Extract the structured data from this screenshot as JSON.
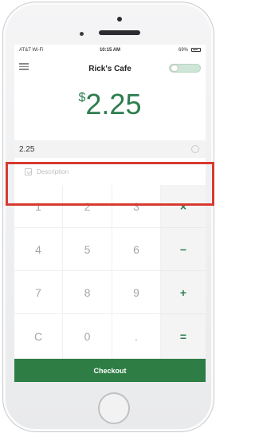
{
  "status_bar": {
    "carrier": "AT&T Wi-Fi",
    "time": "10:15 AM",
    "battery": "69%"
  },
  "header": {
    "title": "Rick's Cafe"
  },
  "amount": {
    "currency": "$",
    "value": "2.25"
  },
  "entry": {
    "value": "2.25"
  },
  "description": {
    "placeholder": "Description"
  },
  "keypad": {
    "keys": [
      "1",
      "2",
      "3",
      "4",
      "5",
      "6",
      "7",
      "8",
      "9",
      "C",
      "0",
      "."
    ],
    "operators": [
      "×",
      "−",
      "+",
      "="
    ]
  },
  "checkout": {
    "label": "Checkout"
  },
  "colors": {
    "accent": "#2e7d45",
    "highlight": "#d83a30"
  }
}
